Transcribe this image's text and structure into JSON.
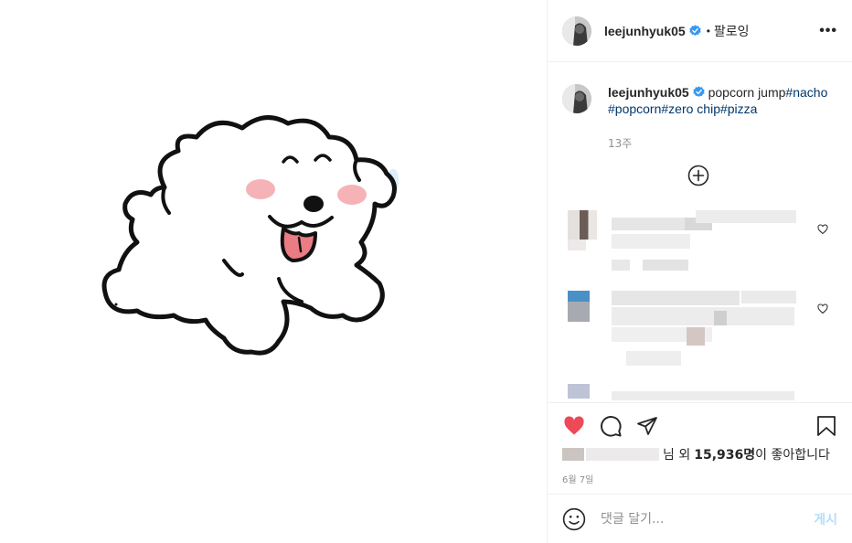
{
  "header": {
    "username": "leejunhyuk05",
    "separator": "•",
    "follow_label": "팔로잉",
    "more_label": "•••"
  },
  "caption": {
    "username": "leejunhyuk05",
    "text": "popcorn jump",
    "tags": [
      "#nacho",
      "#popcorn",
      "#zero chip",
      "#pizza"
    ],
    "time_ago": "13주"
  },
  "likes": {
    "suffix_name": "님 외",
    "count": "15,936명",
    "suffix": "이 좋아합니다"
  },
  "date": "6월 7일",
  "comment_box": {
    "placeholder": "댓글 달기...",
    "post_label": "게시"
  },
  "colors": {
    "verified": "#3897f0",
    "liked_heart": "#ed4956",
    "link": "#00376b",
    "post_button": "#b2dffc"
  },
  "icons": [
    "verified-badge-icon",
    "more-icon",
    "load-more-plus-icon",
    "heart-icon",
    "comment-icon",
    "share-icon",
    "bookmark-icon",
    "emoji-icon"
  ]
}
